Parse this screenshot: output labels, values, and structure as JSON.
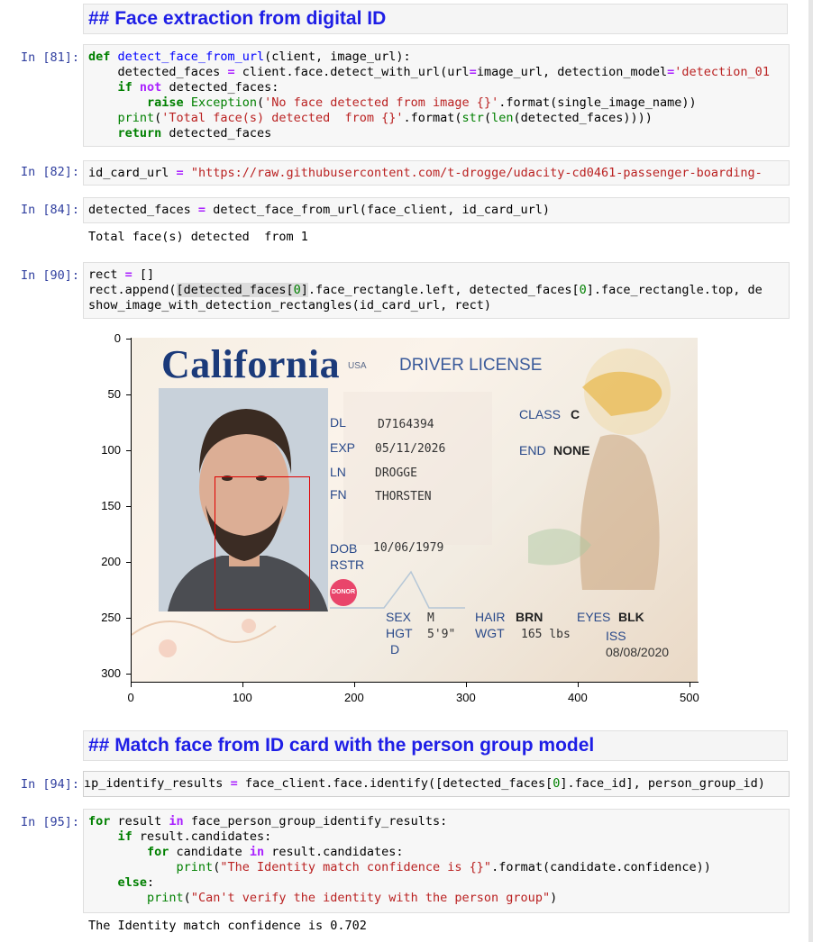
{
  "cells": {
    "md1": {
      "text": "## Face extraction from digital ID"
    },
    "c81": {
      "prompt": "In [81]:",
      "lines": [
        "def detect_face_from_url(client, image_url):",
        "    detected_faces = client.face.detect_with_url(url=image_url, detection_model='detection_01",
        "    if not detected_faces:",
        "        raise Exception('No face detected from image {}'.format(single_image_name))",
        "    print('Total face(s) detected  from {}'.format(str(len(detected_faces))))",
        "    return detected_faces"
      ]
    },
    "c82": {
      "prompt": "In [82]:",
      "line": "id_card_url = \"https://raw.githubusercontent.com/t-drogge/udacity-cd0461-passenger-boarding-"
    },
    "c84": {
      "prompt": "In [84]:",
      "line": "detected_faces = detect_face_from_url(face_client, id_card_url)",
      "output": "Total face(s) detected  from 1"
    },
    "c90": {
      "prompt": "In [90]:",
      "lines": [
        "rect = []",
        "rect.append([detected_faces[0].face_rectangle.left, detected_faces[0].face_rectangle.top, de",
        "show_image_with_detection_rectangles(id_card_url, rect)"
      ]
    },
    "md2": {
      "text": "## Match face from ID card with the person group model"
    },
    "c94": {
      "prompt": "In [94]:",
      "line": "ıp_identify_results = face_client.face.identify([detected_faces[0].face_id], person_group_id)"
    },
    "c95": {
      "prompt": "In [95]:",
      "lines": [
        "for result in face_person_group_identify_results:",
        "    if result.candidates:",
        "        for candidate in result.candidates:",
        "            print(\"The Identity match confidence is {}\".format(candidate.confidence))",
        "    else:",
        "        print(\"Can't verify the identity with the person group\")"
      ],
      "output": "The Identity match confidence is 0.702"
    }
  },
  "plot": {
    "y_ticks": [
      "0",
      "50",
      "100",
      "150",
      "200",
      "250",
      "300"
    ],
    "x_ticks": [
      "0",
      "100",
      "200",
      "300",
      "400",
      "500"
    ],
    "card": {
      "title": "California",
      "usa": "USA",
      "license_type": "DRIVER LICENSE",
      "dl_label": "DL",
      "dl_value": "D7164394",
      "exp_label": "EXP",
      "exp_value": "05/11/2026",
      "ln_label": "LN",
      "ln_value": "DROGGE",
      "fn_label": "FN",
      "fn_value": "THORSTEN",
      "class_label": "CLASS",
      "class_value": "C",
      "end_label": "END",
      "end_value": "NONE",
      "dob_label": "DOB",
      "dob_value": "10/06/1979",
      "rstr_label": "RSTR",
      "donor": "DONOR",
      "sex_label": "SEX",
      "sex_value": "M",
      "hgt_label": "HGT",
      "hgt_value": "5'9\"",
      "hair_label": "HAIR",
      "hair_value": "BRN",
      "eyes_label": "EYES",
      "eyes_value": "BLK",
      "wgt_label": "WGT",
      "wgt_value": "165 lbs",
      "iss_label": "ISS",
      "iss_value": "08/08/2020",
      "dd_label": "D"
    }
  }
}
